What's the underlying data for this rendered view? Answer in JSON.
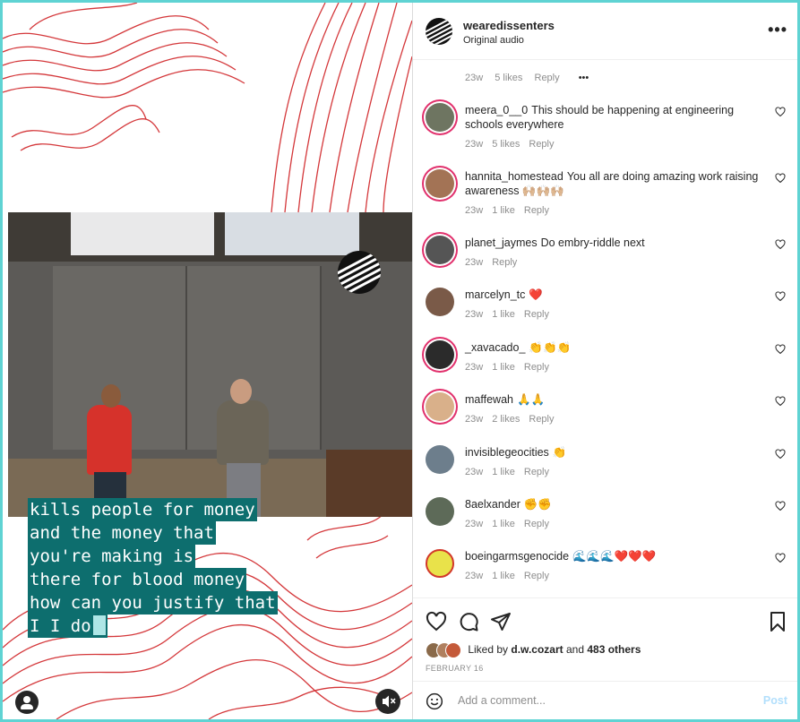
{
  "post": {
    "username": "wearedissenters",
    "audio": "Original audio",
    "more_label": "•••"
  },
  "video": {
    "captions": [
      "kills people for money",
      "and the money that",
      "you're making is",
      "there for blood money",
      "how can you justify that",
      "I I do"
    ]
  },
  "partial_comment": {
    "age": "23w",
    "likes": "5 likes",
    "reply": "Reply",
    "more": "•••"
  },
  "comments": [
    {
      "user": "meera_0__0",
      "text": "This should be happening at engineering schools everywhere",
      "age": "23w",
      "likes": "5 likes",
      "reply": "Reply"
    },
    {
      "user": "hannita_homestead",
      "text": "You all are doing amazing work raising awareness 🙌🏼🙌🏼🙌🏼",
      "age": "23w",
      "likes": "1 like",
      "reply": "Reply"
    },
    {
      "user": "planet_jaymes",
      "text": "Do embry-riddle next",
      "age": "23w",
      "likes": "",
      "reply": "Reply"
    },
    {
      "user": "marcelyn_tc",
      "text": "❤️",
      "age": "23w",
      "likes": "1 like",
      "reply": "Reply"
    },
    {
      "user": "_xavacado_",
      "text": "👏👏👏",
      "age": "23w",
      "likes": "1 like",
      "reply": "Reply"
    },
    {
      "user": "maffewah",
      "text": "🙏🙏",
      "age": "23w",
      "likes": "2 likes",
      "reply": "Reply"
    },
    {
      "user": "invisiblegeocities",
      "text": "👏",
      "age": "23w",
      "likes": "1 like",
      "reply": "Reply"
    },
    {
      "user": "8aelxander",
      "text": "✊✊",
      "age": "23w",
      "likes": "1 like",
      "reply": "Reply"
    },
    {
      "user": "boeingarmsgenocide",
      "text": "🌊🌊🌊❤️❤️❤️",
      "age": "23w",
      "likes": "1 like",
      "reply": "Reply"
    }
  ],
  "likes_line": {
    "prefix": "Liked by",
    "user": "d.w.cozart",
    "middle": "and",
    "others": "483 others"
  },
  "date": "FEBRUARY 16",
  "add_comment": {
    "placeholder": "Add a comment...",
    "post_label": "Post"
  },
  "colors": {
    "caption_bg": "#0d6e6e",
    "topo_line": "#d4373a",
    "frame": "#5fd3d3",
    "story_ring": "#e1306c"
  }
}
